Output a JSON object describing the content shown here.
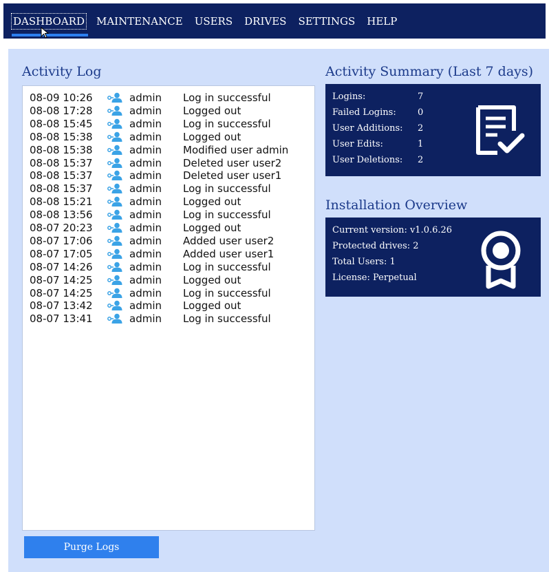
{
  "nav": {
    "items": [
      {
        "label": "DASHBOARD",
        "active": true
      },
      {
        "label": "MAINTENANCE"
      },
      {
        "label": "USERS"
      },
      {
        "label": "DRIVES"
      },
      {
        "label": "SETTINGS"
      },
      {
        "label": "HELP"
      }
    ]
  },
  "activity_log": {
    "title": "Activity Log",
    "entries": [
      {
        "time": "08-09 10:26",
        "user": "admin",
        "message": "Log in successful"
      },
      {
        "time": "08-08 17:28",
        "user": "admin",
        "message": "Logged out"
      },
      {
        "time": "08-08 15:45",
        "user": "admin",
        "message": "Log in successful"
      },
      {
        "time": "08-08 15:38",
        "user": "admin",
        "message": "Logged out"
      },
      {
        "time": "08-08 15:38",
        "user": "admin",
        "message": "Modified user admin"
      },
      {
        "time": "08-08 15:37",
        "user": "admin",
        "message": "Deleted user user2"
      },
      {
        "time": "08-08 15:37",
        "user": "admin",
        "message": "Deleted user user1"
      },
      {
        "time": "08-08 15:37",
        "user": "admin",
        "message": "Log in successful"
      },
      {
        "time": "08-08 15:21",
        "user": "admin",
        "message": "Logged out"
      },
      {
        "time": "08-08 13:56",
        "user": "admin",
        "message": "Log in successful"
      },
      {
        "time": "08-07 20:23",
        "user": "admin",
        "message": "Logged out"
      },
      {
        "time": "08-07 17:06",
        "user": "admin",
        "message": "Added user user2"
      },
      {
        "time": "08-07 17:05",
        "user": "admin",
        "message": "Added user user1"
      },
      {
        "time": "08-07 14:26",
        "user": "admin",
        "message": "Log in successful"
      },
      {
        "time": "08-07 14:25",
        "user": "admin",
        "message": "Logged out"
      },
      {
        "time": "08-07 14:25",
        "user": "admin",
        "message": "Log in successful"
      },
      {
        "time": "08-07 13:42",
        "user": "admin",
        "message": "Logged out"
      },
      {
        "time": "08-07 13:41",
        "user": "admin",
        "message": "Log in successful"
      }
    ],
    "purge_label": "Purge Logs",
    "user_icon": "user-key-icon"
  },
  "summary": {
    "title": "Activity Summary (Last 7 days)",
    "rows": [
      {
        "label": "Logins:",
        "value": "7"
      },
      {
        "label": "Failed Logins:",
        "value": "0"
      },
      {
        "label": "User Additions:",
        "value": "2"
      },
      {
        "label": "User Edits:",
        "value": "1"
      },
      {
        "label": "User Deletions:",
        "value": "2"
      }
    ],
    "icon": "document-check-icon"
  },
  "installation": {
    "title": "Installation Overview",
    "rows": [
      {
        "text": "Current version: v1.0.6.26"
      },
      {
        "text": "Protected drives: 2"
      },
      {
        "text": "Total Users: 1"
      },
      {
        "text": "License: Perpetual"
      }
    ],
    "icon": "award-ribbon-icon"
  },
  "colors": {
    "navbar": "#0d2160",
    "accent": "#2f80ed",
    "background": "#d0dffb",
    "user_icon": "#3ba3e6"
  }
}
